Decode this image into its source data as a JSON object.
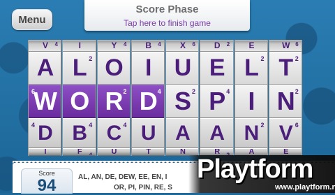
{
  "header": {
    "menu_label": "Menu",
    "phase_title": "Score Phase",
    "phase_subtitle": "Tap here to finish game"
  },
  "board": {
    "columns": [
      {
        "top": {
          "letter": "V",
          "points": "4"
        },
        "r1": {
          "letter": "A",
          "points": ""
        },
        "mid": {
          "letter": "W",
          "points": "6"
        },
        "r3": {
          "letter": "D",
          "points": "4"
        },
        "bot": {
          "letter": "I",
          "points": ""
        }
      },
      {
        "top": {
          "letter": "I",
          "points": ""
        },
        "r1": {
          "letter": "L",
          "points": "2"
        },
        "mid": {
          "letter": "O",
          "points": ""
        },
        "r3": {
          "letter": "B",
          "points": "4"
        },
        "bot": {
          "letter": "F",
          "points": "4"
        }
      },
      {
        "top": {
          "letter": "Y",
          "points": "4"
        },
        "r1": {
          "letter": "O",
          "points": ""
        },
        "mid": {
          "letter": "R",
          "points": "2"
        },
        "r3": {
          "letter": "C",
          "points": "4"
        },
        "bot": {
          "letter": "U",
          "points": ""
        }
      },
      {
        "top": {
          "letter": "B",
          "points": "4"
        },
        "r1": {
          "letter": "I",
          "points": ""
        },
        "mid": {
          "letter": "D",
          "points": "4"
        },
        "r3": {
          "letter": "U",
          "points": ""
        },
        "bot": {
          "letter": "T",
          "points": ""
        }
      },
      {
        "top": {
          "letter": "X",
          "points": "6"
        },
        "r1": {
          "letter": "U",
          "points": ""
        },
        "mid": {
          "letter": "S",
          "points": "2"
        },
        "r3": {
          "letter": "A",
          "points": ""
        },
        "bot": {
          "letter": "N",
          "points": ""
        }
      },
      {
        "top": {
          "letter": "D",
          "points": "2"
        },
        "r1": {
          "letter": "E",
          "points": ""
        },
        "mid": {
          "letter": "P",
          "points": "4"
        },
        "r3": {
          "letter": "A",
          "points": ""
        },
        "bot": {
          "letter": "R",
          "points": "2"
        }
      },
      {
        "top": {
          "letter": "E",
          "points": ""
        },
        "r1": {
          "letter": "L",
          "points": "2"
        },
        "mid": {
          "letter": "I",
          "points": ""
        },
        "r3": {
          "letter": "N",
          "points": "2"
        },
        "bot": {
          "letter": "A",
          "points": ""
        }
      },
      {
        "top": {
          "letter": "W",
          "points": "6"
        },
        "r1": {
          "letter": "T",
          "points": "2"
        },
        "mid": {
          "letter": "N",
          "points": "2"
        },
        "r3": {
          "letter": "V",
          "points": "6"
        },
        "bot": {
          "letter": "E",
          "points": ""
        }
      }
    ],
    "selected_row": "mid",
    "selected_columns": [
      0,
      1,
      2,
      3
    ]
  },
  "score": {
    "label": "Score",
    "value": "94"
  },
  "found_words": {
    "line1": "AL, AN, DE, DEW, EE, EN, I",
    "line2": "OR, PI, PIN, RE, S"
  },
  "watermark": {
    "logo": "Playtform",
    "url": "www.playtform.net"
  },
  "colors": {
    "accent_purple": "#6b2c9f",
    "letter_purple": "#4b1e7a",
    "background_blue": "#1f6a9a"
  }
}
